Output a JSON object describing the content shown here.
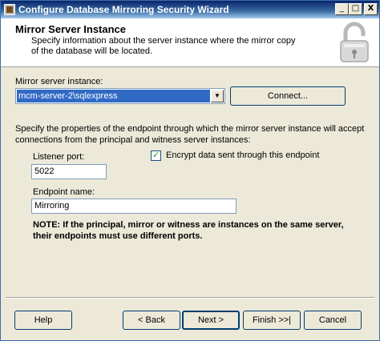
{
  "window": {
    "title": "Configure Database Mirroring Security Wizard",
    "minimize_glyph": "_",
    "maximize_glyph": "□",
    "close_glyph": "X"
  },
  "header": {
    "title": "Mirror Server Instance",
    "subtitle": "Specify information about the server instance where the mirror copy of the database will be located.",
    "icon": "padlock-icon"
  },
  "mirror": {
    "label": "Mirror server instance:",
    "value": "mcm-server-2\\sqlexpress",
    "arrow_glyph": "▼",
    "connect_label": "Connect..."
  },
  "endpoint": {
    "description": "Specify the properties of the endpoint through which the mirror server instance will accept connections from the principal and witness server instances:",
    "listener_port_label": "Listener port:",
    "listener_port_value": "5022",
    "encrypt_label": "Encrypt data sent through this endpoint",
    "encrypt_checked": true,
    "check_glyph": "✓",
    "endpoint_name_label": "Endpoint name:",
    "endpoint_name_value": "Mirroring",
    "note": "NOTE: If the principal, mirror or witness are instances on the same server, their endpoints must use different ports."
  },
  "footer": {
    "help_label": "Help",
    "back_label": "< Back",
    "next_label": "Next >",
    "finish_label": "Finish >>|",
    "cancel_label": "Cancel"
  }
}
